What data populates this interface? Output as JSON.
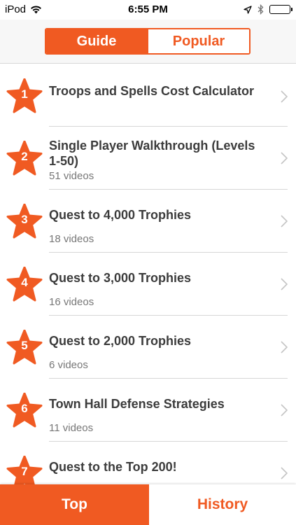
{
  "status_bar": {
    "carrier": "iPod",
    "time": "6:55 PM"
  },
  "segmented_control": {
    "selected": "Guide",
    "options": [
      "Guide",
      "Popular"
    ]
  },
  "accent_color": "#f05a22",
  "list": [
    {
      "number": "1",
      "title": "Troops and Spells Cost Calculator",
      "subtitle": ""
    },
    {
      "number": "2",
      "title": "Single Player Walkthrough (Levels 1-50)",
      "subtitle": "51 videos"
    },
    {
      "number": "3",
      "title": "Quest to 4,000 Trophies",
      "subtitle": "18 videos"
    },
    {
      "number": "4",
      "title": "Quest to 3,000 Trophies",
      "subtitle": "16 videos"
    },
    {
      "number": "5",
      "title": "Quest to 2,000 Trophies",
      "subtitle": "6 videos"
    },
    {
      "number": "6",
      "title": "Town Hall Defense Strategies",
      "subtitle": "11 videos"
    },
    {
      "number": "7",
      "title": "Quest to the Top 200!",
      "subtitle": ""
    }
  ],
  "tab_bar": {
    "selected": "Top",
    "tabs": [
      "Top",
      "History"
    ]
  }
}
